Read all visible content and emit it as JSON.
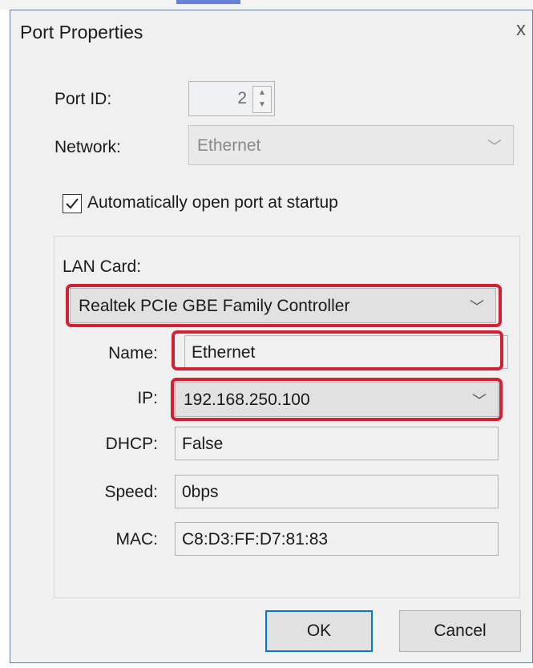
{
  "dialog": {
    "title": "Port Properties",
    "close_glyph": "x"
  },
  "port": {
    "id_label": "Port ID:",
    "id_value": "2",
    "network_label": "Network:",
    "network_value": "Ethernet",
    "auto_open_label": "Automatically open port at startup",
    "auto_open_checked": true
  },
  "lan": {
    "card_label": "LAN Card:",
    "card_value": "Realtek PCIe GBE Family Controller",
    "name_label": "Name:",
    "name_value": "Ethernet",
    "ip_label": "IP:",
    "ip_value": "192.168.250.100",
    "dhcp_label": "DHCP:",
    "dhcp_value": "False",
    "speed_label": "Speed:",
    "speed_value": "0bps",
    "mac_label": "MAC:",
    "mac_value": "C8:D3:FF:D7:81:83"
  },
  "buttons": {
    "ok": "OK",
    "cancel": "Cancel"
  },
  "colors": {
    "highlight": "#d32033",
    "default_button_border": "#0078d7"
  }
}
